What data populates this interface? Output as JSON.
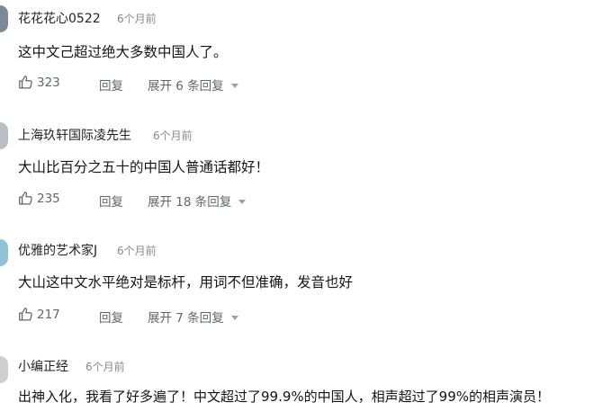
{
  "comments": [
    {
      "username": "花花花心0522",
      "time": "6个月前",
      "text": "这中文己超过绝大多数中国人了。",
      "likes": "323",
      "reply_label": "回复",
      "expand_label": "展开 6 条回复",
      "avatar_color": "#7a8a9a"
    },
    {
      "username": "上海玖轩国际凌先生",
      "time": "6个月前",
      "text": "大山比百分之五十的中国人普通话都好！",
      "likes": "235",
      "reply_label": "回复",
      "expand_label": "展开 18 条回复",
      "avatar_color": "#b9bec5"
    },
    {
      "username": "优雅的艺术家J",
      "time": "6个月前",
      "text": "大山这中文水平绝对是标杆，用词不但准确，发音也好",
      "likes": "217",
      "reply_label": "回复",
      "expand_label": "展开 7 条回复",
      "avatar_color": "#8fc3dc"
    },
    {
      "username": "小编正经",
      "time": "6个月前",
      "text": "出神入化，我看了好多遍了！中文超过了99.9%的中国人，相声超过了99%的相声演员！",
      "avatar_color": "#cfcfcf"
    }
  ]
}
